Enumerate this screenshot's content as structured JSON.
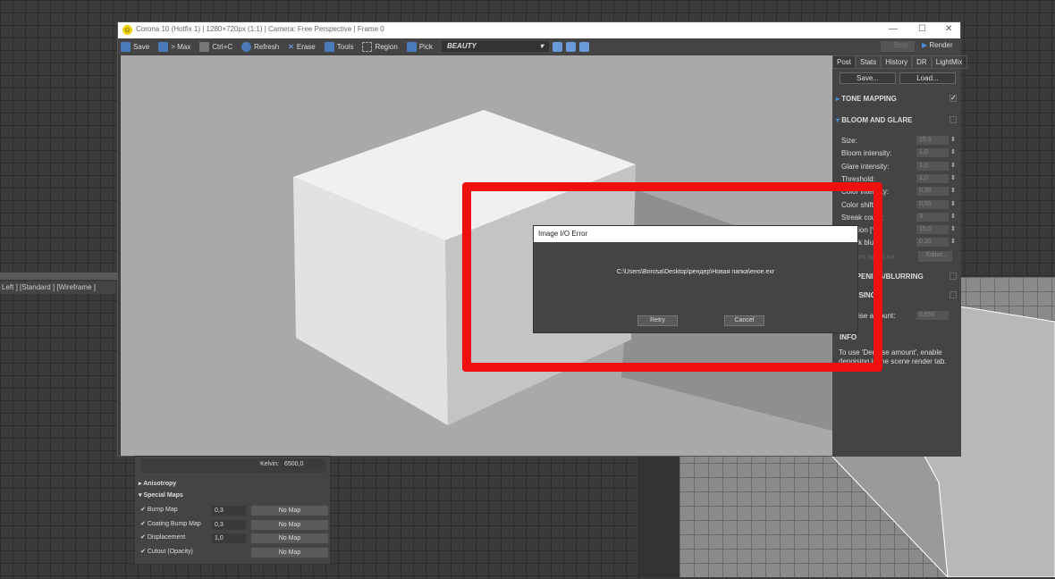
{
  "viewport_left": {
    "label": "Left ] [Standard ] [Wireframe ]"
  },
  "corona": {
    "title": "Corona 10 (Hotfix 1) | 1280×720px (1:1) | Camera: Free Perspective | Frame 0",
    "toolbar": {
      "save": "Save",
      "max": "> Max",
      "copy": "Ctrl+C",
      "refresh": "Refresh",
      "erase": "Erase",
      "tools": "Tools",
      "region": "Region",
      "pick": "Pick",
      "channel": "BEAUTY"
    },
    "stop": "Stop",
    "render": "Render",
    "tabs": [
      "Post",
      "Stats",
      "History",
      "DR",
      "LightMix"
    ],
    "save_btn": "Save...",
    "load_btn": "Load...",
    "tone_mapping": "TONE MAPPING",
    "bloom": "BLOOM AND GLARE",
    "params": [
      {
        "label": "Size:",
        "value": "15,0"
      },
      {
        "label": "Bloom intensity:",
        "value": "1,0"
      },
      {
        "label": "Glare intensity:",
        "value": "1,0"
      },
      {
        "label": "Threshold:",
        "value": "1,0"
      },
      {
        "label": "Color intensity:",
        "value": "0,30"
      },
      {
        "label": "Color shift:",
        "value": "0,50"
      },
      {
        "label": "Streak count:",
        "value": "3"
      },
      {
        "label": "Rotation [°]:",
        "value": "15,0"
      },
      {
        "label": "Streak blur:",
        "value": "0,20"
      }
    ],
    "aperture_label": "Custom aperture:",
    "editor": "Editor...",
    "sharpening": "SHARPENING/BLURRING",
    "denoising": "DENOISING",
    "denoise_label": "Denoise amount:",
    "denoise_value": "0,650",
    "info": "INFO",
    "info_text": "To use 'Denoise amount', enable denoising in the scene render tab."
  },
  "dialog": {
    "title": "Image I/O Error",
    "message": "C:\\Users\\Borosa\\Desktop\\рендер\\Новая папка\\еное.exr",
    "retry": "Retry",
    "cancel": "Cancel"
  },
  "material": {
    "kelvin_label": "Kelvin:",
    "kelvin": "6500,0",
    "anisotropy": "Anisotropy",
    "special": "Special Maps",
    "maps": [
      {
        "label": "Bump Map",
        "value": "0,3",
        "map": "No Map"
      },
      {
        "label": "Coating Bump Map",
        "value": "0,3",
        "map": "No Map"
      },
      {
        "label": "Displacement",
        "value": "1,0",
        "map": "No Map"
      },
      {
        "label": "Cutout (Opacity)",
        "value": "",
        "map": "No Map"
      }
    ]
  }
}
